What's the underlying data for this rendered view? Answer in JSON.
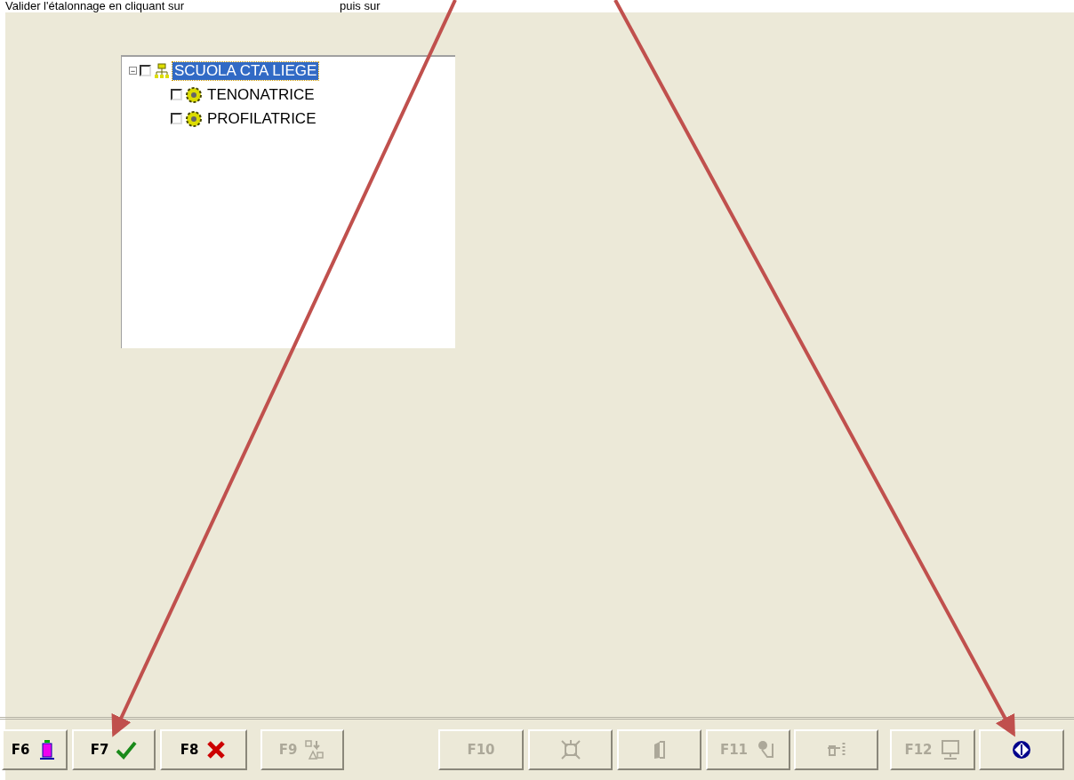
{
  "caption": {
    "texts": [
      "Valider l'étalonnage en cliquant sur",
      "puis sur"
    ]
  },
  "tree": {
    "items": [
      {
        "label": "SCUOLA CTA LIEGE",
        "kind": "network",
        "toggle": "−",
        "checked": false,
        "selected": true,
        "expanded": true,
        "children": [
          {
            "label": "TENONATRICE",
            "kind": "machine",
            "checked": false,
            "selected": false
          },
          {
            "label": "PROFILATRICE",
            "kind": "machine",
            "checked": false,
            "selected": false
          }
        ]
      }
    ]
  },
  "toolbar": {
    "buttons": [
      {
        "key": "F6",
        "disabled": false
      },
      {
        "key": "F7",
        "disabled": false
      },
      {
        "key": "F8",
        "disabled": false
      },
      {
        "key": "F9",
        "disabled": true
      },
      {
        "key": "F10",
        "disabled": true
      },
      {
        "disabled": true
      },
      {
        "disabled": true
      },
      {
        "key": "F11",
        "disabled": true
      },
      {
        "disabled": true
      },
      {
        "key": "F12",
        "disabled": true
      },
      {
        "disabled": false
      }
    ]
  }
}
